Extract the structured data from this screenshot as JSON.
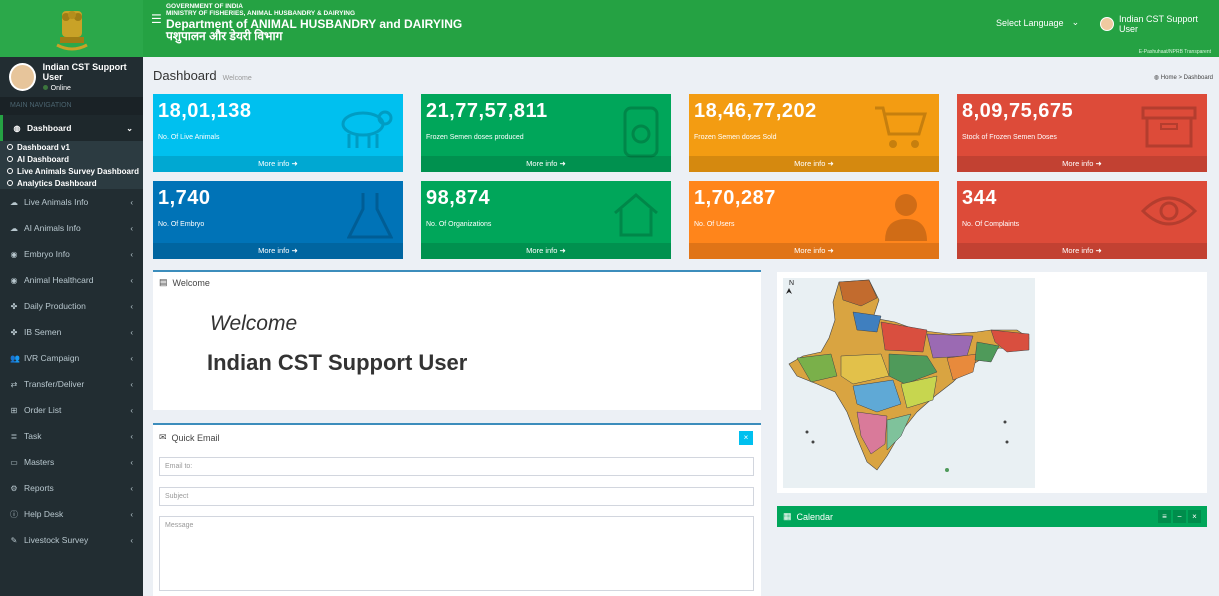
{
  "header": {
    "org_line1": "GOVERNMENT OF INDIA",
    "org_line2": "MINISTRY OF FISHERIES, ANIMAL HUSBANDRY & DAIRYING",
    "org_line3": "Department of ANIMAL HUSBANDRY and DAIRYING",
    "org_line4": "पशुपालन और डेयरी विभाग",
    "language_label": "Select Language",
    "user_name": "Indian CST Support User",
    "tagline": "E-Pashuhaat/NPRB Transparent"
  },
  "sidebar": {
    "user_name": "Indian CST Support User",
    "status": "Online",
    "nav_header": "MAIN NAVIGATION",
    "dashboard_label": "Dashboard",
    "sub_items": [
      "Dashboard v1",
      "AI Dashboard",
      "Live Animals Survey Dashboard",
      "Analytics Dashboard"
    ],
    "items": [
      {
        "label": "Live Animals Info",
        "icon": "cloud-icon"
      },
      {
        "label": "AI Animals Info",
        "icon": "cloud-icon"
      },
      {
        "label": "Embryo Info",
        "icon": "dot-circle-icon"
      },
      {
        "label": "Animal Healthcard",
        "icon": "dot-circle-icon"
      },
      {
        "label": "Daily Production",
        "icon": "puzzle-icon"
      },
      {
        "label": "IB Semen",
        "icon": "puzzle-icon"
      },
      {
        "label": "IVR Campaign",
        "icon": "users-icon"
      },
      {
        "label": "Transfer/Deliver",
        "icon": "shuffle-icon"
      },
      {
        "label": "Order List",
        "icon": "cart-icon"
      },
      {
        "label": "Task",
        "icon": "list-icon"
      },
      {
        "label": "Masters",
        "icon": "monitor-icon"
      },
      {
        "label": "Reports",
        "icon": "gear-icon"
      },
      {
        "label": "Help Desk",
        "icon": "info-icon"
      },
      {
        "label": "Livestock Survey",
        "icon": "pencil-icon"
      }
    ]
  },
  "content": {
    "title": "Dashboard",
    "subtitle": "Welcome",
    "breadcrumb_home": "Home",
    "breadcrumb_current": "Dashboard"
  },
  "stats": [
    {
      "value": "18,01,138",
      "label": "No. Of Live Animals",
      "more": "More info",
      "color": "#00c0ef",
      "icon": "sheep-icon"
    },
    {
      "value": "21,77,57,811",
      "label": "Frozen Semen doses produced",
      "more": "More info",
      "color": "#00a65a",
      "icon": "jar-icon"
    },
    {
      "value": "18,46,77,202",
      "label": "Frozen Semen doses Sold",
      "more": "More info",
      "color": "#f39c12",
      "icon": "cart-icon"
    },
    {
      "value": "8,09,75,675",
      "label": "Stock of Frozen Semen Doses",
      "more": "More info",
      "color": "#dd4b39",
      "icon": "archive-icon"
    },
    {
      "value": "1,740",
      "label": "No. Of Embryo",
      "more": "More info",
      "color": "#0073b7",
      "icon": "flask-icon"
    },
    {
      "value": "98,874",
      "label": "No. Of Organizations",
      "more": "More info",
      "color": "#00a65a",
      "icon": "home-icon"
    },
    {
      "value": "1,70,287",
      "label": "No. Of Users",
      "more": "More info",
      "color": "#ff851b",
      "icon": "user-icon"
    },
    {
      "value": "344",
      "label": "No. Of Complaints",
      "more": "More info",
      "color": "#dd4b39",
      "icon": "eye-icon"
    }
  ],
  "welcome": {
    "header": "Welcome",
    "line1": "Welcome",
    "line2": "Indian CST Support User"
  },
  "quick_email": {
    "header": "Quick Email",
    "email_placeholder": "Email to:",
    "subject_placeholder": "Subject",
    "message_placeholder": "Message"
  },
  "calendar": {
    "header": "Calendar"
  },
  "map": {
    "north_label": "N"
  }
}
